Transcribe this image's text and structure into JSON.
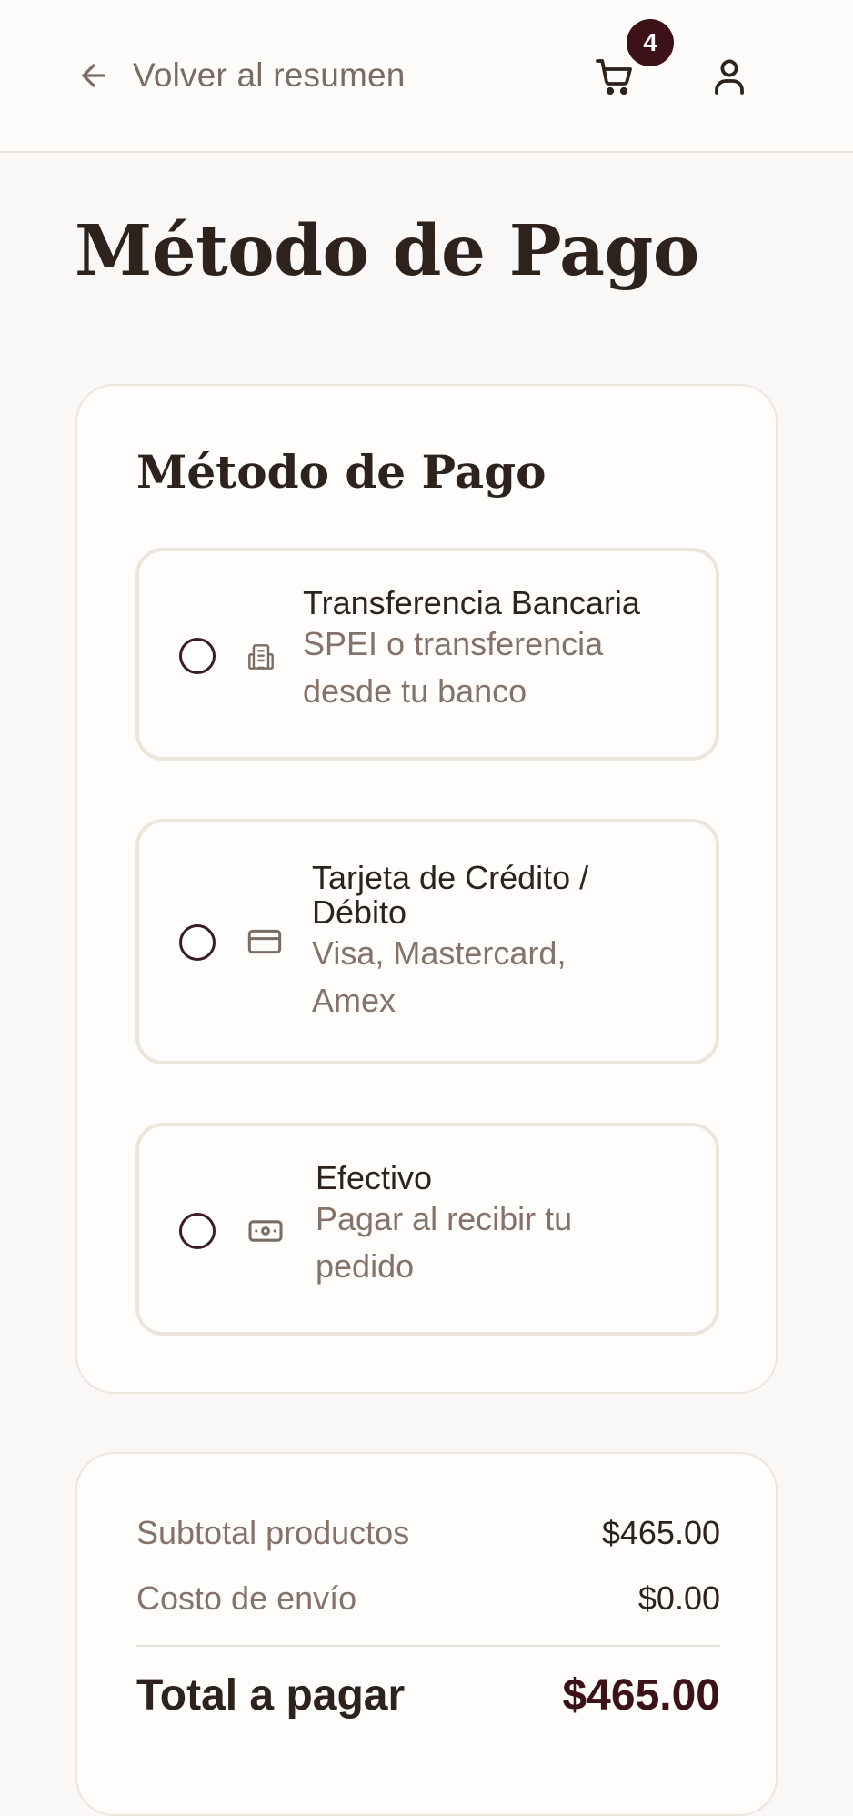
{
  "header": {
    "back_label": "Volver al resumen",
    "cart_count": "4"
  },
  "page": {
    "title": "Método de Pago"
  },
  "payment": {
    "section_title": "Método de Pago",
    "options": [
      {
        "title": "Transferencia Bancaria",
        "desc_line1": "SPEI o transferencia",
        "desc_line2": "desde tu banco",
        "icon": "bank-icon",
        "selected": false
      },
      {
        "title_line1": "Tarjeta de Crédito /",
        "title_line2": "Débito",
        "desc_line1": "Visa, Mastercard,",
        "desc_line2": "Amex",
        "icon": "credit-card-icon",
        "selected": false
      },
      {
        "title": "Efectivo",
        "desc_line1": "Pagar al recibir tu",
        "desc_line2": "pedido",
        "icon": "cash-icon",
        "selected": false
      }
    ]
  },
  "summary": {
    "subtotal_label": "Subtotal productos",
    "subtotal_value": "$465.00",
    "shipping_label": "Costo de envío",
    "shipping_value": "$0.00",
    "total_label": "Total a pagar",
    "total_value": "$465.00"
  },
  "colors": {
    "background": "#f9f8f6",
    "accent": "#3c1118",
    "text": "#2d221c",
    "muted_text": "#85736a",
    "border": "#ebe5dc"
  }
}
